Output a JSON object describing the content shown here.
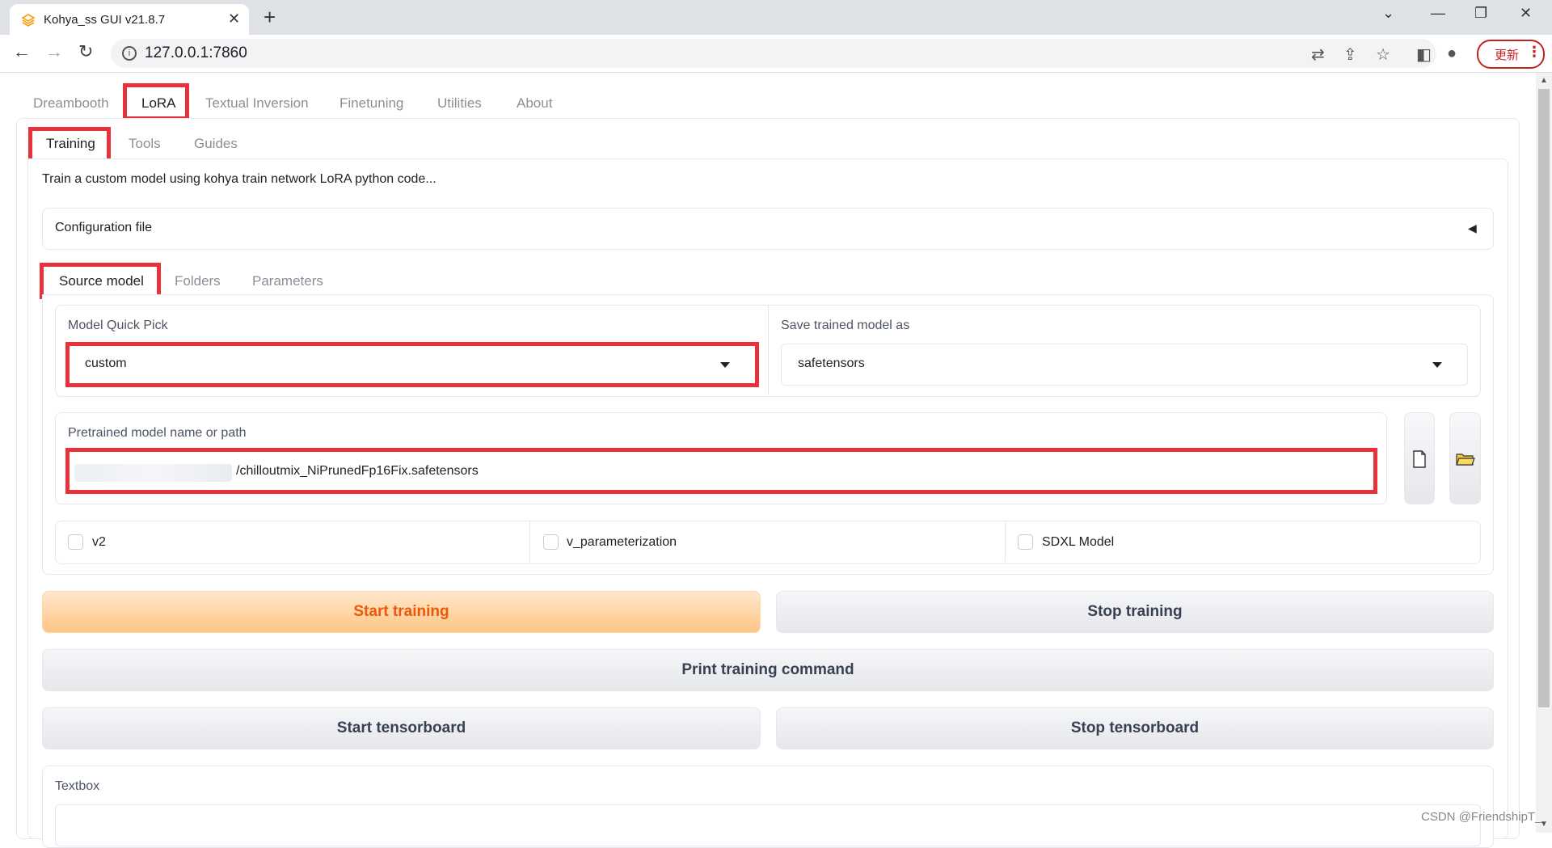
{
  "browser": {
    "tab_title": "Kohya_ss GUI v21.8.7",
    "url": "127.0.0.1:7860",
    "update_label": "更新"
  },
  "main_tabs": [
    "Dreambooth",
    "LoRA",
    "Textual Inversion",
    "Finetuning",
    "Utilities",
    "About"
  ],
  "sub_tabs": [
    "Training",
    "Tools",
    "Guides"
  ],
  "description": "Train a custom model using kohya train network LoRA python code...",
  "config_file_label": "Configuration file",
  "section_tabs": [
    "Source model",
    "Folders",
    "Parameters"
  ],
  "model_quick_pick": {
    "label": "Model Quick Pick",
    "value": "custom"
  },
  "save_model_as": {
    "label": "Save trained model as",
    "value": "safetensors"
  },
  "pretrained": {
    "label": "Pretrained model name or path",
    "value": "/chilloutmix_NiPrunedFp16Fix.safetensors"
  },
  "checkboxes": [
    {
      "label": "v2",
      "checked": false
    },
    {
      "label": "v_parameterization",
      "checked": false
    },
    {
      "label": "SDXL Model",
      "checked": false
    }
  ],
  "buttons": {
    "start_training": "Start training",
    "stop_training": "Stop training",
    "print_command": "Print training command",
    "start_tensorboard": "Start tensorboard",
    "stop_tensorboard": "Stop tensorboard"
  },
  "textbox_label": "Textbox",
  "watermark": "CSDN @FriendshipT_",
  "colors": {
    "highlight": "#e8313a",
    "primary_button": "#fdc585",
    "primary_text": "#ea580c"
  }
}
